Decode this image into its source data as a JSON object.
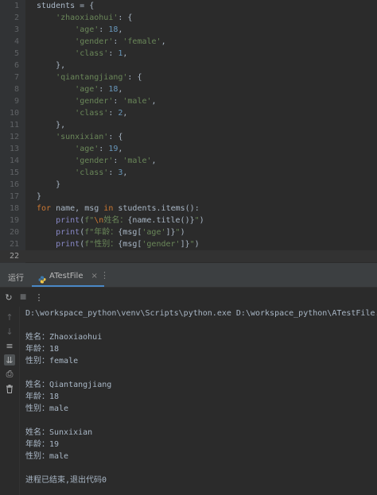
{
  "editor": {
    "current_line": 22,
    "lines": [
      {
        "n": "1",
        "html": "students = {"
      },
      {
        "n": "2",
        "html": "    <span class=\"str\">'zhaoxiaohui'</span>: {"
      },
      {
        "n": "3",
        "html": "        <span class=\"str\">'age'</span>: <span class=\"num\">18</span>,"
      },
      {
        "n": "4",
        "html": "        <span class=\"str\">'gender'</span>: <span class=\"str\">'female'</span>,"
      },
      {
        "n": "5",
        "html": "        <span class=\"str\">'class'</span>: <span class=\"num\">1</span>,"
      },
      {
        "n": "6",
        "html": "    },"
      },
      {
        "n": "7",
        "html": "    <span class=\"str\">'qiantangjiang'</span>: {"
      },
      {
        "n": "8",
        "html": "        <span class=\"str\">'age'</span>: <span class=\"num\">18</span>,"
      },
      {
        "n": "9",
        "html": "        <span class=\"str\">'gender'</span>: <span class=\"str\">'male'</span>,"
      },
      {
        "n": "10",
        "html": "        <span class=\"str\">'class'</span>: <span class=\"num\">2</span>,"
      },
      {
        "n": "11",
        "html": "    },"
      },
      {
        "n": "12",
        "html": "    <span class=\"str\">'sunxixian'</span>: {"
      },
      {
        "n": "13",
        "html": "        <span class=\"str\">'age'</span>: <span class=\"num\">19</span>,"
      },
      {
        "n": "14",
        "html": "        <span class=\"str\">'gender'</span>: <span class=\"str\">'male'</span>,"
      },
      {
        "n": "15",
        "html": "        <span class=\"str\">'class'</span>: <span class=\"num\">3</span>,"
      },
      {
        "n": "16",
        "html": "    }"
      },
      {
        "n": "17",
        "html": "}"
      },
      {
        "n": "18",
        "html": "<span class=\"kw\">for</span> name, msg <span class=\"kw\">in</span> students.items():"
      },
      {
        "n": "19",
        "html": "    <span class=\"fn\">print</span>(<span class=\"str\">f\"<span class=\"esc\">\\n</span>姓名：</span>{name.title()}<span class=\"str\">\"</span>)"
      },
      {
        "n": "20",
        "html": "    <span class=\"fn\">print</span>(<span class=\"str\">f\"年龄：</span>{msg[<span class=\"str\">'age'</span>]}<span class=\"str\">\"</span>)"
      },
      {
        "n": "21",
        "html": "    <span class=\"fn\">print</span>(<span class=\"str\">f\"性别：</span>{msg[<span class=\"str\">'gender'</span>]}<span class=\"str\">\"</span>)"
      },
      {
        "n": "22",
        "html": ""
      }
    ]
  },
  "panel": {
    "run_label": "运行",
    "tab_label": "ATestFile",
    "tab_close": "×",
    "more": "⋮"
  },
  "icons": {
    "rerun": "↻",
    "stop": "■",
    "up": "↑",
    "down": "↓",
    "soft_wrap": "≡",
    "scroll_end": "⇊",
    "print": "⎙",
    "trash": "🗑"
  },
  "console": {
    "lines": [
      {
        "cls": "cmd",
        "text": "D:\\workspace_python\\venv\\Scripts\\python.exe D:\\workspace_python\\ATestFile.py"
      },
      {
        "cls": "out",
        "text": ""
      },
      {
        "cls": "out",
        "text": "姓名：Zhaoxiaohui"
      },
      {
        "cls": "out",
        "text": "年龄：18"
      },
      {
        "cls": "out",
        "text": "性别：female"
      },
      {
        "cls": "out",
        "text": ""
      },
      {
        "cls": "out",
        "text": "姓名：Qiantangjiang"
      },
      {
        "cls": "out",
        "text": "年龄：18"
      },
      {
        "cls": "out",
        "text": "性别：male"
      },
      {
        "cls": "out",
        "text": ""
      },
      {
        "cls": "out",
        "text": "姓名：Sunxixian"
      },
      {
        "cls": "out",
        "text": "年龄：19"
      },
      {
        "cls": "out",
        "text": "性别：male"
      },
      {
        "cls": "out",
        "text": ""
      },
      {
        "cls": "exit",
        "text": "进程已结束,退出代码0"
      }
    ]
  }
}
